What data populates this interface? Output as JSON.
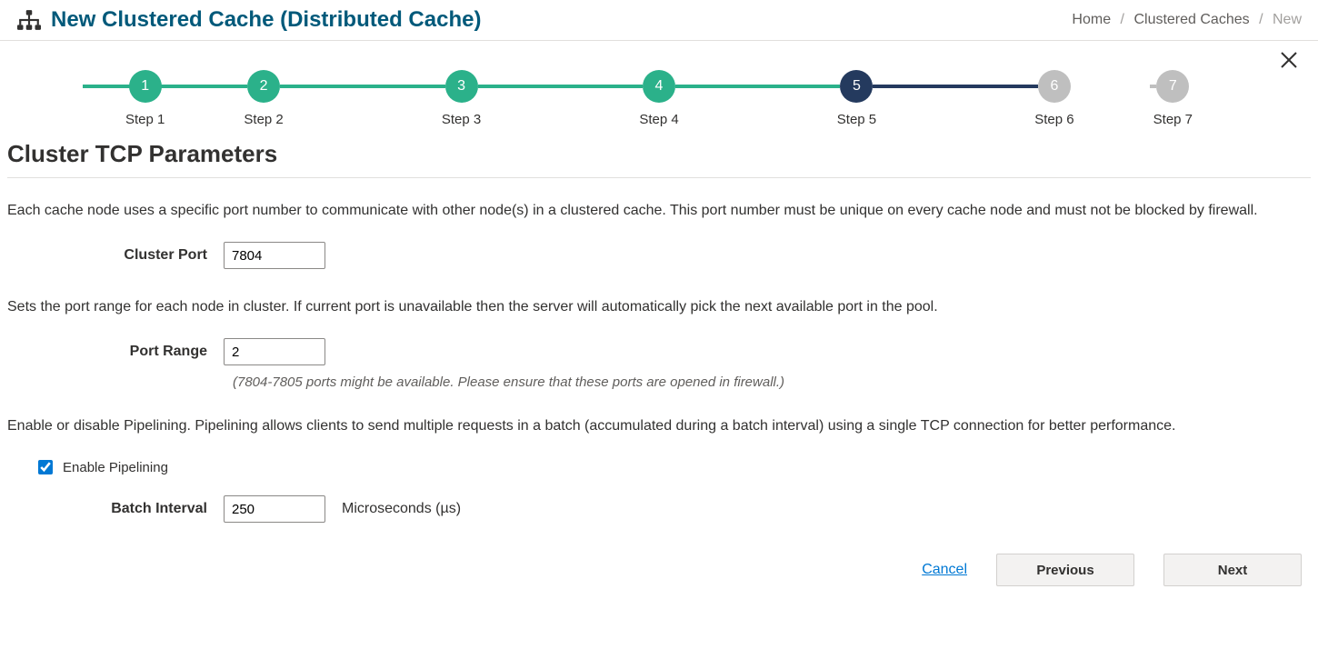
{
  "header": {
    "title": "New Clustered Cache (Distributed Cache)"
  },
  "breadcrumb": {
    "items": [
      "Home",
      "Clustered Caches"
    ],
    "current": "New"
  },
  "stepper": {
    "steps": [
      {
        "num": "1",
        "label": "Step 1",
        "state": "done"
      },
      {
        "num": "2",
        "label": "Step 2",
        "state": "done"
      },
      {
        "num": "3",
        "label": "Step 3",
        "state": "done"
      },
      {
        "num": "4",
        "label": "Step 4",
        "state": "done"
      },
      {
        "num": "5",
        "label": "Step 5",
        "state": "current"
      },
      {
        "num": "6",
        "label": "Step 6",
        "state": "future"
      },
      {
        "num": "7",
        "label": "Step 7",
        "state": "future"
      }
    ]
  },
  "section": {
    "title": "Cluster TCP Parameters"
  },
  "cluster_port": {
    "desc": "Each cache node uses a specific port number to communicate with other node(s) in a clustered cache. This port number must be unique on every cache node and must not be blocked by firewall.",
    "label": "Cluster Port",
    "value": "7804"
  },
  "port_range": {
    "desc": "Sets the port range for each node in cluster. If current port is unavailable then the server will automatically pick the next available port in the pool.",
    "label": "Port Range",
    "value": "2",
    "hint": "(7804-7805 ports might be available. Please ensure that these ports are opened in firewall.)"
  },
  "pipelining": {
    "desc": "Enable or disable Pipelining. Pipelining allows clients to send multiple requests in a batch (accumulated during a batch interval) using a single TCP connection for better performance.",
    "checkbox_label": "Enable Pipelining",
    "checked": true,
    "batch_label": "Batch Interval",
    "batch_value": "250",
    "unit": "Microseconds (µs)"
  },
  "footer": {
    "cancel": "Cancel",
    "previous": "Previous",
    "next": "Next"
  }
}
